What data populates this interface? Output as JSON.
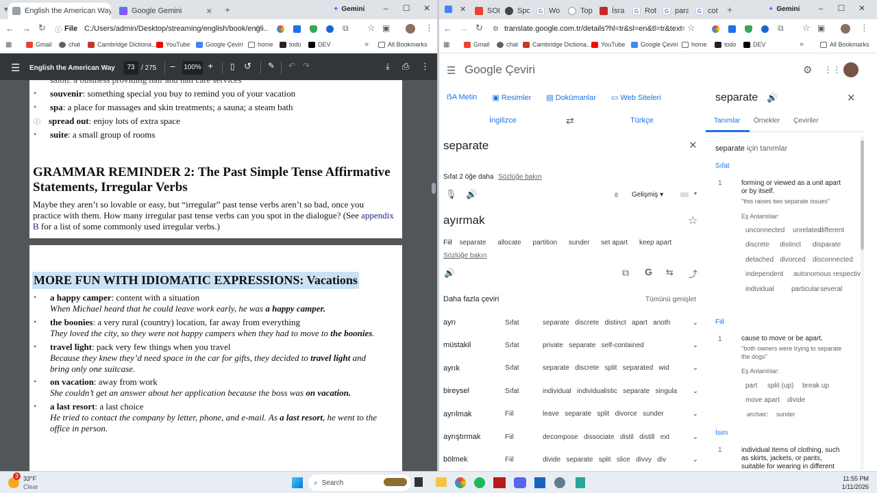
{
  "left_window": {
    "tabs": [
      {
        "label": "English the American Way",
        "active": true
      },
      {
        "label": "Google Gemini",
        "active": false
      }
    ],
    "gemini_label": "Gemini",
    "file_label": "File",
    "address": "C:/Users/admin/Desktop/streaming/english/book/engli...",
    "bookmarks": [
      "Gmail",
      "chat",
      "Cambridge Dictiona...",
      "YouTube",
      "Google Çeviri",
      "home",
      "todo",
      "DEV"
    ],
    "all_bookmarks": "All Bookmarks",
    "pdf": {
      "title": "English the American Way",
      "page": "73",
      "total": "/ 275",
      "zoom": "100%"
    },
    "page1": {
      "cut": "salon: a business providing hair and nail care services",
      "items": [
        {
          "term": "souvenir",
          "def": ": something special you buy to remind you of your vacation"
        },
        {
          "term": "spa",
          "def": ": a place for massages and skin treatments; a sauna; a steam bath"
        },
        {
          "term": "spread out",
          "def": ": enjoy lots of extra space"
        },
        {
          "term": "suite",
          "def": ": a small group of rooms"
        }
      ],
      "heading": "GRAMMAR REMINDER 2: The Past Simple Tense Affirmative Statements, Irregular Verbs",
      "para1": "Maybe they aren’t so lovable or easy, but “irregular” past tense verbs aren’t so bad, once you",
      "para2_pre": "practice with them. How many irregular past tense verbs can you spot in the dialogue? (See ",
      "para2_link": "appendix",
      "para3_link": "B",
      "para3_post": " for a list of some commonly used irregular verbs.)"
    },
    "page2": {
      "heading": "MORE FUN WITH IDIOMATIC EXPRESSIONS: Vacations",
      "items": [
        {
          "term": "a happy camper",
          "def": ": content with a situation",
          "ex": "When Michael heard that he could leave work early, he was ",
          "exb": "a happy camper.",
          "ex2": ""
        },
        {
          "term": "the boonies",
          "def": ": a very rural (country) location, far away from everything",
          "ex": "They loved the city, so they were not happy campers when they had to move to ",
          "exb": "the boonies",
          "ex2": "."
        },
        {
          "term": "travel light",
          "def": ": pack very few things when you travel",
          "ex": "Because they knew they’d need space in the car for gifts, they decided to ",
          "exb": "travel light",
          "ex2": " and"
        },
        {
          "term": "on vacation",
          "def": ": away from work",
          "ex": "She couldn’t get an answer about her application because the boss was ",
          "exb": "on vacation.",
          "ex2": ""
        },
        {
          "term": "a last resort",
          "def": ": a last choice",
          "ex": "He tried to contact the company by letter, phone, and e-mail. As ",
          "exb": "a last resort",
          "ex2": ", he went to the"
        }
      ],
      "cont3": "bring only one suitcase.",
      "cont5": "office in person."
    }
  },
  "right_window": {
    "tabs": [
      "SOF",
      "Spo",
      "Wo",
      "Top",
      "İsra",
      "Rot",
      "para",
      "cot"
    ],
    "gemini_label": "Gemini",
    "address": "translate.google.com.tr/details?hl=tr&sl=en&tl=tr&text=se...",
    "bookmarks": [
      "Gmail",
      "chat",
      "Cambridge Dictiona...",
      "YouTube",
      "Google Çeviri",
      "home",
      "todo",
      "DEV"
    ],
    "all_bookmarks": "All Bookmarks",
    "app_name": "Google Çeviri",
    "modes": [
      "Metin",
      "Resimler",
      "Dokümanlar",
      "Web Siteleri"
    ],
    "source_lang": "İngilizce",
    "target_lang": "Türkçe",
    "source_text": "separate",
    "source_note": "Sıfat 2 öğe daha",
    "dict_link": "Sözlüğe bakın",
    "char_count": "8",
    "advanced": "Gelişmiş",
    "result": "ayırmak",
    "result_pos": "Fiil",
    "result_syns": [
      "separate",
      "allocate",
      "partition",
      "sunder",
      "set apart",
      "keep apart"
    ],
    "more_title": "Daha fazla çeviri",
    "expand_all": "Tümünü genişlet",
    "more": [
      {
        "word": "ayrı",
        "pos": "Sıfat",
        "syns": "separate   discrete   distinct   apart   anoth"
      },
      {
        "word": "müstakil",
        "pos": "Sıfat",
        "syns": "private   separate   self-contained"
      },
      {
        "word": "ayrık",
        "pos": "Sıfat",
        "syns": "separate   discrete   split   separated   wid"
      },
      {
        "word": "bireysel",
        "pos": "Sıfat",
        "syns": "individual   individualistic   separate   singula"
      },
      {
        "word": "ayrılmak",
        "pos": "Fiil",
        "syns": "leave   separate   split   divorce   sunder"
      },
      {
        "word": "ayrıştırmak",
        "pos": "Fiil",
        "syns": "decompose   dissociate   distil   distill   ext"
      },
      {
        "word": "bölmek",
        "pos": "Fiil",
        "syns": "divide   separate   split   slice   divvy   div"
      }
    ],
    "panel": {
      "word": "separate",
      "tabs": [
        "Tanımlar",
        "Örnekler",
        "Çeviriler"
      ],
      "defs_title_word": "separate",
      "defs_title_rest": " için tanımlar",
      "adj": "Sıfat",
      "d1_num": "1",
      "d1_a": "forming or viewed as a unit apart",
      "d1_b": "or by itself.",
      "d1_ex": "\"this raises two separate issues\"",
      "syn_label": "Eş Anlamlılar:",
      "syn1": [
        "unconnected",
        "unrelated",
        "different",
        "discrete",
        "distinct",
        "disparate",
        "detached",
        "divorced",
        "disconnected",
        "independent",
        "autonomous",
        "respective",
        "individual",
        "particular",
        "several"
      ],
      "verb": "Fiil",
      "d2_num": "1",
      "d2_a": "cause to move or be apart.",
      "d2_ex1": "\"both owners were trying to separate",
      "d2_ex2": "the dogs\"",
      "syn2": [
        "part",
        "split (up)",
        "break up",
        "move apart",
        "divide"
      ],
      "archaic": "archaic:",
      "archaic_word": "sunder",
      "noun": "İsim",
      "d3_num": "1",
      "d3_a": "individual items of clothing, such",
      "d3_b": "as skirts, jackets, or pants,",
      "d3_c": "suitable for wearing in different"
    }
  },
  "taskbar": {
    "temp": "33°F",
    "weather": "Clear",
    "badge": "3",
    "search": "Search",
    "time": "11:55 PM",
    "date": "1/11/2026"
  }
}
